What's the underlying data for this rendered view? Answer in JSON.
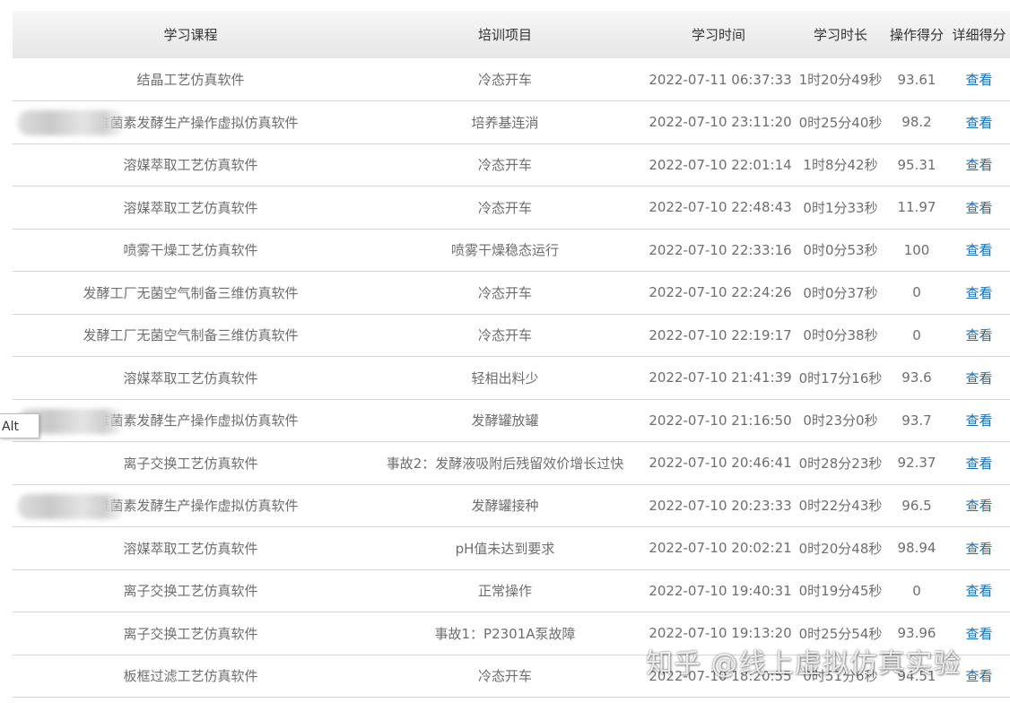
{
  "table": {
    "headers": {
      "course": "学习课程",
      "project": "培训项目",
      "time": "学习时间",
      "duration": "学习时长",
      "score": "操作得分",
      "detail": "详细得分"
    },
    "view_label": "查看",
    "rows": [
      {
        "course": "结晶工艺仿真软件",
        "project": "冷态开车",
        "time": "2022-07-11 06:37:33",
        "duration": "1时20分49秒",
        "score": "93.61"
      },
      {
        "course": "阿维菌素发酵生产操作虚拟仿真软件",
        "project": "培养基连消",
        "time": "2022-07-10 23:11:20",
        "duration": "0时25分40秒",
        "score": "98.2"
      },
      {
        "course": "溶媒萃取工艺仿真软件",
        "project": "冷态开车",
        "time": "2022-07-10 22:01:14",
        "duration": "1时8分42秒",
        "score": "95.31"
      },
      {
        "course": "溶媒萃取工艺仿真软件",
        "project": "冷态开车",
        "time": "2022-07-10 22:48:43",
        "duration": "0时1分33秒",
        "score": "11.97"
      },
      {
        "course": "喷雾干燥工艺仿真软件",
        "project": "喷雾干燥稳态运行",
        "time": "2022-07-10 22:33:16",
        "duration": "0时0分53秒",
        "score": "100"
      },
      {
        "course": "发酵工厂无菌空气制备三维仿真软件",
        "project": "冷态开车",
        "time": "2022-07-10 22:24:26",
        "duration": "0时0分37秒",
        "score": "0"
      },
      {
        "course": "发酵工厂无菌空气制备三维仿真软件",
        "project": "冷态开车",
        "time": "2022-07-10 22:19:17",
        "duration": "0时0分38秒",
        "score": "0"
      },
      {
        "course": "溶媒萃取工艺仿真软件",
        "project": "轻相出料少",
        "time": "2022-07-10 21:41:39",
        "duration": "0时17分16秒",
        "score": "93.6"
      },
      {
        "course": "阿维菌素发酵生产操作虚拟仿真软件",
        "project": "发酵罐放罐",
        "time": "2022-07-10 21:16:50",
        "duration": "0时23分0秒",
        "score": "93.7"
      },
      {
        "course": "离子交换工艺仿真软件",
        "project": "事故2：发酵液吸附后残留效价增长过快",
        "time": "2022-07-10 20:46:41",
        "duration": "0时28分23秒",
        "score": "92.37"
      },
      {
        "course": "阿维菌素发酵生产操作虚拟仿真软件",
        "project": "发酵罐接种",
        "time": "2022-07-10 20:23:33",
        "duration": "0时22分43秒",
        "score": "96.5"
      },
      {
        "course": "溶媒萃取工艺仿真软件",
        "project": "pH值未达到要求",
        "time": "2022-07-10 20:02:21",
        "duration": "0时20分48秒",
        "score": "98.94"
      },
      {
        "course": "离子交换工艺仿真软件",
        "project": "正常操作",
        "time": "2022-07-10 19:40:31",
        "duration": "0时19分45秒",
        "score": "0"
      },
      {
        "course": "离子交换工艺仿真软件",
        "project": "事故1：P2301A泵故障",
        "time": "2022-07-10 19:13:20",
        "duration": "0时25分54秒",
        "score": "93.96"
      },
      {
        "course": "板框过滤工艺仿真软件",
        "project": "冷态开车",
        "time": "2022-07-10 18:20:55",
        "duration": "0时51分6秒",
        "score": "94.51"
      }
    ]
  },
  "side_tab": {
    "label": "Alt"
  },
  "watermark": {
    "text": "知乎 @线上虚拟仿真实验"
  },
  "colors": {
    "link": "#1e6ba8",
    "text": "#6e6e6e",
    "header_bg": "#ececec"
  }
}
